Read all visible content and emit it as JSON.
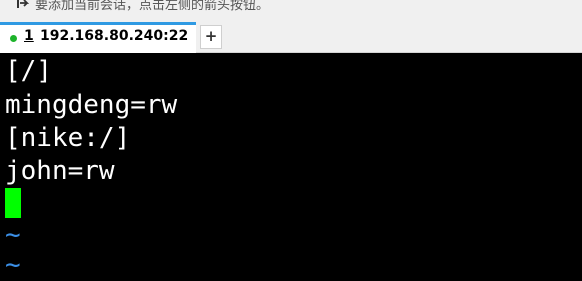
{
  "hint": {
    "icon": "send-icon",
    "text": "要添加当前会话，点击左侧的箭头按钮。"
  },
  "tabs": [
    {
      "status_color": "#1db32b",
      "index": "1",
      "title": "192.168.80.240:22",
      "active": true
    }
  ],
  "new_tab_label": "+",
  "terminal": {
    "lines": [
      "[/]",
      "mingdeng=rw",
      "[nike:/]",
      "john=rw"
    ],
    "empty_line_marker": "~",
    "cursor_color": "#00ff00",
    "text_color": "#ffffff",
    "background": "#000000",
    "tilde_color": "#3b8fe6"
  },
  "colors": {
    "tab_accent": "#2f9ae3"
  }
}
